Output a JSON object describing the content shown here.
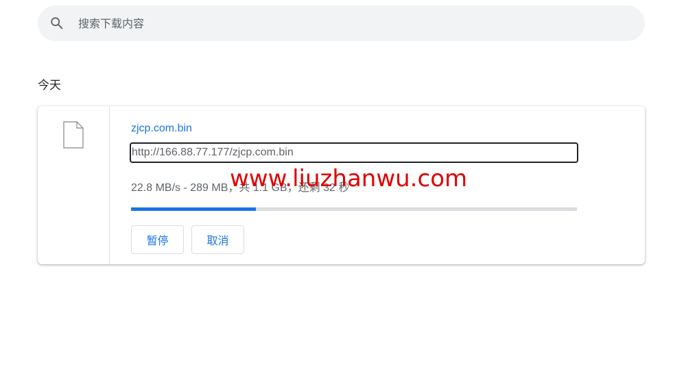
{
  "search": {
    "placeholder": "搜索下载内容"
  },
  "date_heading": "今天",
  "download": {
    "file_name": "zjcp.com.bin",
    "url": "http://166.88.77.177/zjcp.com.bin",
    "status": "22.8 MB/s - 289 MB，共 1.1 GB，还剩 32 秒",
    "progress": 0.28,
    "pause_label": "暂停",
    "cancel_label": "取消"
  },
  "watermark": "www.liuzhanwu.com",
  "colors": {
    "accent": "#1a73e8",
    "watermark": "#e00000"
  }
}
